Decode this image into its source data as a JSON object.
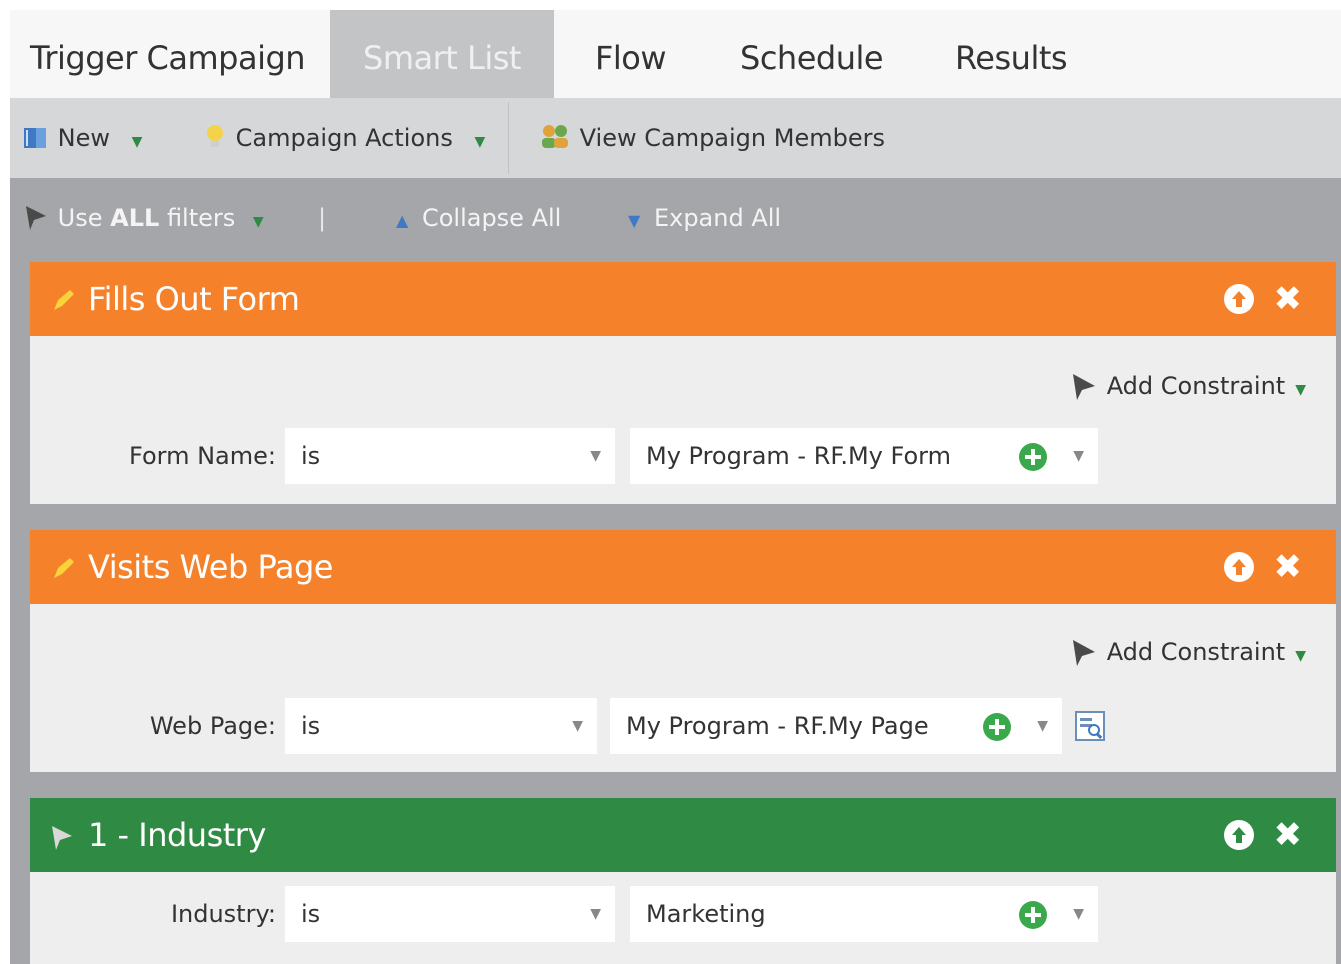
{
  "tabs": [
    {
      "label": "Trigger Campaign",
      "active": false
    },
    {
      "label": "Smart List",
      "active": true
    },
    {
      "label": "Flow",
      "active": false
    },
    {
      "label": "Schedule",
      "active": false
    },
    {
      "label": "Results",
      "active": false
    }
  ],
  "toolbar": {
    "new_label": "New",
    "campaign_actions_label": "Campaign Actions",
    "view_members_label": "View Campaign Members"
  },
  "filter_toolbar": {
    "use_prefix": "Use",
    "use_all": "ALL",
    "use_suffix": "filters",
    "separator": "|",
    "collapse_all": "Collapse All",
    "expand_all": "Expand All"
  },
  "filters": [
    {
      "title": "Fills Out Form",
      "color": "#f5812a",
      "add_constraint": "Add Constraint",
      "field_label": "Form Name:",
      "operator": "is",
      "value": "My Program - RF.My Form"
    },
    {
      "title": "Visits Web Page",
      "color": "#f5812a",
      "add_constraint": "Add Constraint",
      "field_label": "Web Page:",
      "operator": "is",
      "value": "My Program - RF.My Page"
    },
    {
      "title": "1 - Industry",
      "color": "#2f8a44",
      "field_label": "Industry:",
      "operator": "is",
      "value": "Marketing"
    }
  ],
  "colors": {
    "accent_orange": "#f5812a",
    "accent_green": "#2f8a44",
    "toolbar_gray": "#d6d7d9",
    "panel_gray": "#a5a6a9"
  }
}
